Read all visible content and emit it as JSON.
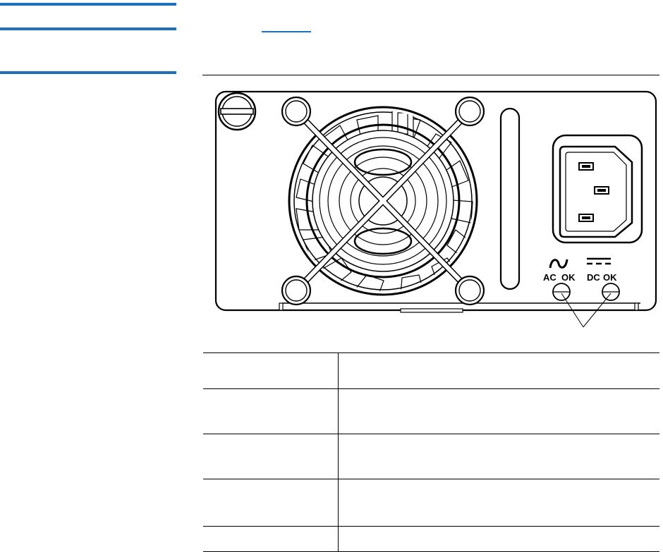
{
  "colors": {
    "accent_rule": "#1f6fbf",
    "line": "#000000",
    "background": "#ffffff"
  },
  "link": {
    "text": ""
  },
  "psu_panel": {
    "labels": {
      "ac": "AC",
      "ac_ok": "OK",
      "dc": "DC",
      "dc_ok": "OK"
    },
    "icons": {
      "ac_symbol": "~",
      "dc_symbol": "===="
    }
  },
  "table": {
    "rows": [
      {
        "a": "",
        "b": ""
      },
      {
        "a": "",
        "b": ""
      },
      {
        "a": "",
        "b": ""
      },
      {
        "a": "",
        "b": ""
      },
      {
        "a": "",
        "b": ""
      }
    ]
  }
}
